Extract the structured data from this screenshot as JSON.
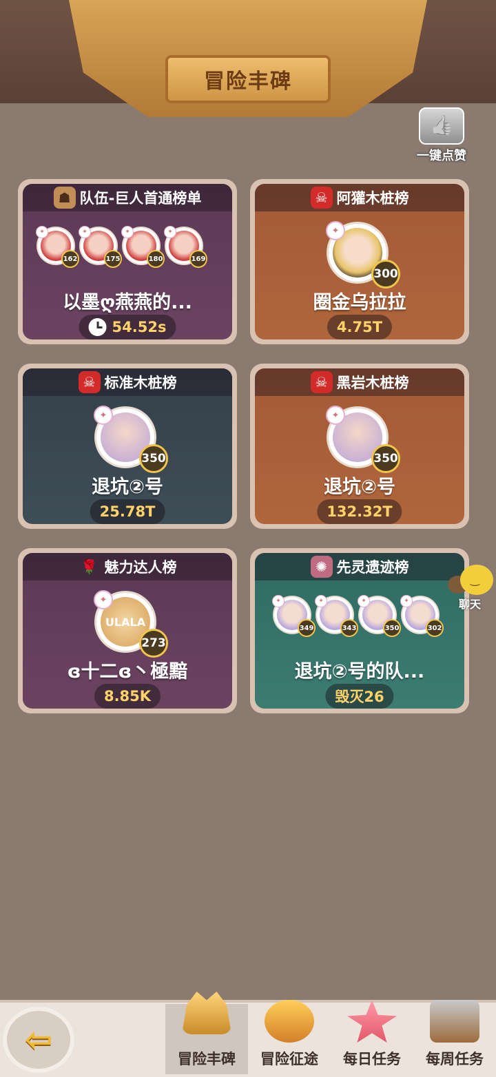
{
  "header": {
    "title": "冒险丰碑"
  },
  "like_button": {
    "label": "一键点赞"
  },
  "chat_button": {
    "label": "聊天"
  },
  "cards": [
    {
      "title": "队伍-巨人首通榜单",
      "name": "以墨ღ燕燕的...",
      "score": "54.52s",
      "avatars": [
        {
          "level": "162"
        },
        {
          "level": "175"
        },
        {
          "level": "180"
        },
        {
          "level": "169"
        }
      ]
    },
    {
      "title": "阿獾木桩榜",
      "name": "圈金乌拉拉",
      "score": "4.75T",
      "level": "300"
    },
    {
      "title": "标准木桩榜",
      "name": "退坑②号",
      "score": "25.78T",
      "level": "350"
    },
    {
      "title": "黑岩木桩榜",
      "name": "退坑②号",
      "score": "132.32T",
      "level": "350"
    },
    {
      "title": "魅力达人榜",
      "name": "ɞ十二ɞ丶極黯",
      "score": "8.85K",
      "level": "273",
      "logo_text": "ULALA"
    },
    {
      "title": "先灵遗迹榜",
      "name": "退坑②号的队...",
      "score": "毁灭26",
      "avatars": [
        {
          "level": "349"
        },
        {
          "level": "343"
        },
        {
          "level": "350"
        },
        {
          "level": "302"
        }
      ]
    }
  ],
  "bottom_tabs": [
    {
      "label": "冒险丰碑",
      "icon": "crown-icon",
      "active": true
    },
    {
      "label": "冒险征途",
      "icon": "medal-icon",
      "active": false
    },
    {
      "label": "每日任务",
      "icon": "starfish-icon",
      "active": false
    },
    {
      "label": "每周任务",
      "icon": "chest-icon",
      "active": false
    }
  ]
}
